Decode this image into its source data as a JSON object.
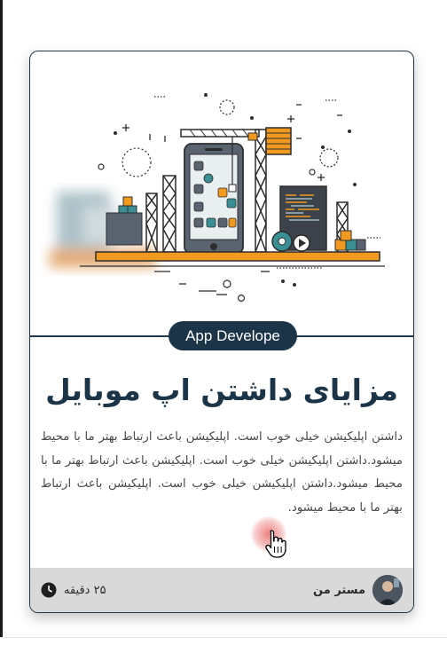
{
  "card": {
    "category_badge": "App Develope",
    "title": "مزایای داشتن اپ موبایل",
    "body": "داشتن اپلیکیشن خیلی خوب است. اپلیکیشن باعث ارتباط بهتر ما با محیط میشود.داشتن اپلیکیشن خیلی خوب است. اپلیکیشن باعث ارتباط بهتر ما با محیط میشود.داشتن اپلیکیشن خیلی خوب است. اپلیکیشن باعث ارتباط بهتر ما با محیط میشود.",
    "illustration_icon": "mobile-app-construction-illustration"
  },
  "footer": {
    "author_name": "مستر من",
    "read_time": "۲۵ دقیقه",
    "clock_icon": "clock-icon"
  },
  "colors": {
    "navy": "#1b3448",
    "accent_orange": "#f29a1f",
    "teal": "#3a8f95",
    "footer_bg": "#d9d9d9",
    "cursor_highlight": "#e63c3c"
  }
}
